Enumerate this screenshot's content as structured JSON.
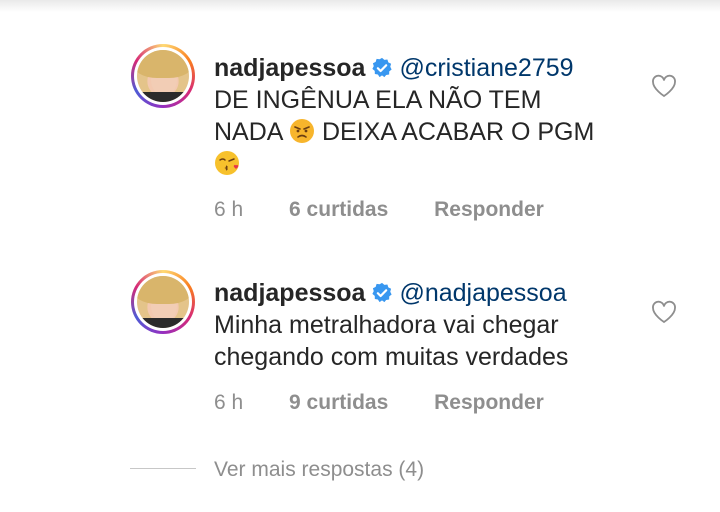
{
  "comments": [
    {
      "username": "nadjapessoa",
      "mention": "@cristiane2759",
      "text_line1": "DE INGÊNUA ELA NÃO TEM",
      "text_line2_a": "NADA",
      "text_line2_b": "DEIXA ACABAR O PGM",
      "time": "6 h",
      "likes": "6 curtidas",
      "reply": "Responder"
    },
    {
      "username": "nadjapessoa",
      "mention": "@nadjapessoa",
      "text_line1": "Minha metralhadora vai chegar",
      "text_line2": "chegando com muitas verdades",
      "time": "6 h",
      "likes": "9 curtidas",
      "reply": "Responder"
    }
  ],
  "more_replies": "Ver mais respostas (4)",
  "icons": {
    "verified": "verified-badge-icon",
    "like": "heart-outline-icon",
    "emoji1": "angry-face-emoji",
    "emoji2": "kissing-face-emoji"
  },
  "colors": {
    "verified_blue": "#3897f0",
    "mention": "#00376b",
    "meta_gray": "#8e8e8e"
  }
}
